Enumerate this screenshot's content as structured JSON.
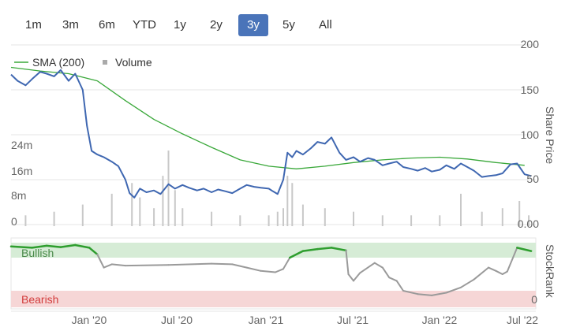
{
  "range_selector": {
    "buttons": [
      {
        "label": "1m"
      },
      {
        "label": "3m"
      },
      {
        "label": "6m"
      },
      {
        "label": "YTD"
      },
      {
        "label": "1y"
      },
      {
        "label": "2y"
      },
      {
        "label": "3y",
        "active": true
      },
      {
        "label": "5y"
      },
      {
        "label": "All"
      }
    ]
  },
  "legend": {
    "sma_label": "SMA (200)",
    "volume_label": "Volume"
  },
  "axes": {
    "share_price_title": "Share Price",
    "stockrank_title": "StockRank",
    "price_ticks": [
      "200",
      "150",
      "100",
      "50",
      "0.00"
    ],
    "volume_ticks": [
      "24m",
      "16m",
      "8m",
      "0"
    ],
    "rank_bottom_tick": "0",
    "x_ticks": [
      "Jan '20",
      "Jul '20",
      "Jan '21",
      "Jul '21",
      "Jan '22",
      "Jul '22"
    ]
  },
  "bands": {
    "bullish": "Bullish",
    "bearish": "Bearish"
  },
  "colors": {
    "price_line": "#3f67b1",
    "sma_line": "#3aa83a",
    "volume_bars": "#c8c8c8",
    "rank_bullish": "#2e9e2e",
    "rank_neutral": "#9a9a9a",
    "bullish_band": "#d6ecd6",
    "bearish_band": "#f6d6d6",
    "bearish_text": "#d23c3c",
    "active_button": "#4a74b9"
  },
  "chart_data": [
    {
      "type": "line",
      "series": [
        {
          "name": "SMA (200)",
          "x": [
            "2019-07-01",
            "2019-09-01",
            "2019-11-01",
            "2020-01-01",
            "2020-03-01",
            "2020-05-01",
            "2020-07-01",
            "2020-09-01",
            "2020-11-01",
            "2021-01-01",
            "2021-03-01",
            "2021-05-01",
            "2021-07-01",
            "2021-09-01",
            "2021-11-01",
            "2022-01-01",
            "2022-03-01",
            "2022-05-01",
            "2022-07-01"
          ],
          "values": [
            175,
            171,
            168,
            160,
            138,
            117,
            101,
            86,
            72,
            65,
            62,
            65,
            69,
            72,
            74,
            75,
            73,
            69,
            66
          ]
        },
        {
          "name": "Share Price",
          "x": [
            "2019-07-01",
            "2019-07-15",
            "2019-08-01",
            "2019-08-15",
            "2019-09-01",
            "2019-09-15",
            "2019-10-01",
            "2019-10-15",
            "2019-11-01",
            "2019-11-15",
            "2019-12-01",
            "2019-12-10",
            "2019-12-20",
            "2020-01-01",
            "2020-01-15",
            "2020-02-01",
            "2020-02-15",
            "2020-03-01",
            "2020-03-10",
            "2020-03-20",
            "2020-04-01",
            "2020-04-15",
            "2020-05-01",
            "2020-05-15",
            "2020-06-01",
            "2020-06-15",
            "2020-07-01",
            "2020-07-15",
            "2020-08-01",
            "2020-08-15",
            "2020-09-01",
            "2020-09-15",
            "2020-10-01",
            "2020-10-15",
            "2020-11-01",
            "2020-11-15",
            "2020-12-01",
            "2020-12-15",
            "2021-01-01",
            "2021-01-10",
            "2021-01-20",
            "2021-02-01",
            "2021-02-10",
            "2021-02-20",
            "2021-03-01",
            "2021-03-15",
            "2021-04-01",
            "2021-04-15",
            "2021-05-01",
            "2021-05-15",
            "2021-06-01",
            "2021-06-15",
            "2021-07-01",
            "2021-07-15",
            "2021-08-01",
            "2021-08-15",
            "2021-09-01",
            "2021-09-15",
            "2021-10-01",
            "2021-10-15",
            "2021-11-01",
            "2021-11-15",
            "2021-12-01",
            "2021-12-15",
            "2022-01-01",
            "2022-01-15",
            "2022-02-01",
            "2022-02-15",
            "2022-03-01",
            "2022-03-15",
            "2022-04-01",
            "2022-04-15",
            "2022-05-01",
            "2022-05-15",
            "2022-06-01",
            "2022-06-15",
            "2022-07-01",
            "2022-07-15"
          ],
          "values": [
            167,
            160,
            155,
            162,
            170,
            168,
            165,
            172,
            160,
            168,
            150,
            110,
            82,
            78,
            75,
            70,
            65,
            50,
            35,
            30,
            40,
            36,
            38,
            34,
            45,
            40,
            44,
            41,
            38,
            40,
            36,
            39,
            37,
            35,
            40,
            44,
            42,
            41,
            40,
            37,
            34,
            50,
            80,
            75,
            82,
            78,
            85,
            92,
            90,
            97,
            80,
            72,
            75,
            70,
            74,
            72,
            66,
            68,
            70,
            64,
            62,
            60,
            63,
            59,
            61,
            66,
            62,
            68,
            64,
            60,
            53,
            54,
            55,
            57,
            67,
            68,
            56,
            54
          ]
        }
      ],
      "volume_series": {
        "name": "Volume",
        "x": [
          "2019-08-01",
          "2019-10-01",
          "2019-12-01",
          "2020-02-01",
          "2020-03-15",
          "2020-04-01",
          "2020-05-01",
          "2020-05-20",
          "2020-06-01",
          "2020-06-15",
          "2020-07-01",
          "2020-09-01",
          "2020-11-01",
          "2021-01-01",
          "2021-01-20",
          "2021-02-01",
          "2021-02-10",
          "2021-02-20",
          "2021-03-15",
          "2021-05-01",
          "2021-07-01",
          "2021-09-01",
          "2021-11-01",
          "2022-01-01",
          "2022-02-15",
          "2022-04-01",
          "2022-05-15",
          "2022-06-20",
          "2022-07-10"
        ],
        "values_m": [
          3,
          4,
          6,
          9,
          12,
          8,
          5,
          14,
          21,
          10,
          5,
          4,
          3,
          3,
          4,
          5,
          14,
          12,
          6,
          5,
          4,
          3,
          3,
          3,
          9,
          4,
          5,
          7,
          3
        ]
      },
      "x_ticks": [
        "Jan '20",
        "Jul '20",
        "Jan '21",
        "Jul '21",
        "Jan '22",
        "Jul '22"
      ],
      "ylabel": "Share Price",
      "ylim": [
        0,
        200
      ],
      "volume_ylim_m": [
        0,
        30
      ],
      "legend_position": "top-left"
    },
    {
      "type": "line",
      "series": [
        {
          "name": "StockRank",
          "x": [
            "2019-07-01",
            "2019-08-15",
            "2019-09-15",
            "2019-10-15",
            "2019-11-15",
            "2019-12-15",
            "2020-01-01",
            "2020-01-15",
            "2020-02-01",
            "2020-03-01",
            "2020-06-01",
            "2020-09-01",
            "2020-10-15",
            "2020-11-15",
            "2020-12-15",
            "2021-01-15",
            "2021-02-01",
            "2021-02-15",
            "2021-03-15",
            "2021-04-15",
            "2021-05-15",
            "2021-06-15",
            "2021-06-20",
            "2021-07-01",
            "2021-07-15",
            "2021-08-15",
            "2021-09-01",
            "2021-09-15",
            "2021-10-01",
            "2021-10-15",
            "2021-11-15",
            "2021-12-15",
            "2022-01-15",
            "2022-02-15",
            "2022-03-15",
            "2022-04-15",
            "2022-05-01",
            "2022-05-15",
            "2022-05-25",
            "2022-06-15",
            "2022-07-15"
          ],
          "values": [
            92,
            90,
            93,
            91,
            94,
            90,
            80,
            60,
            65,
            63,
            64,
            66,
            65,
            60,
            55,
            53,
            58,
            75,
            85,
            88,
            90,
            86,
            50,
            40,
            52,
            67,
            60,
            45,
            40,
            25,
            20,
            18,
            22,
            30,
            42,
            60,
            55,
            50,
            54,
            90,
            85
          ],
          "ylim": [
            0,
            100
          ]
        }
      ],
      "bands": [
        "Bullish",
        "Bearish"
      ],
      "ylim": [
        0,
        100
      ]
    }
  ]
}
